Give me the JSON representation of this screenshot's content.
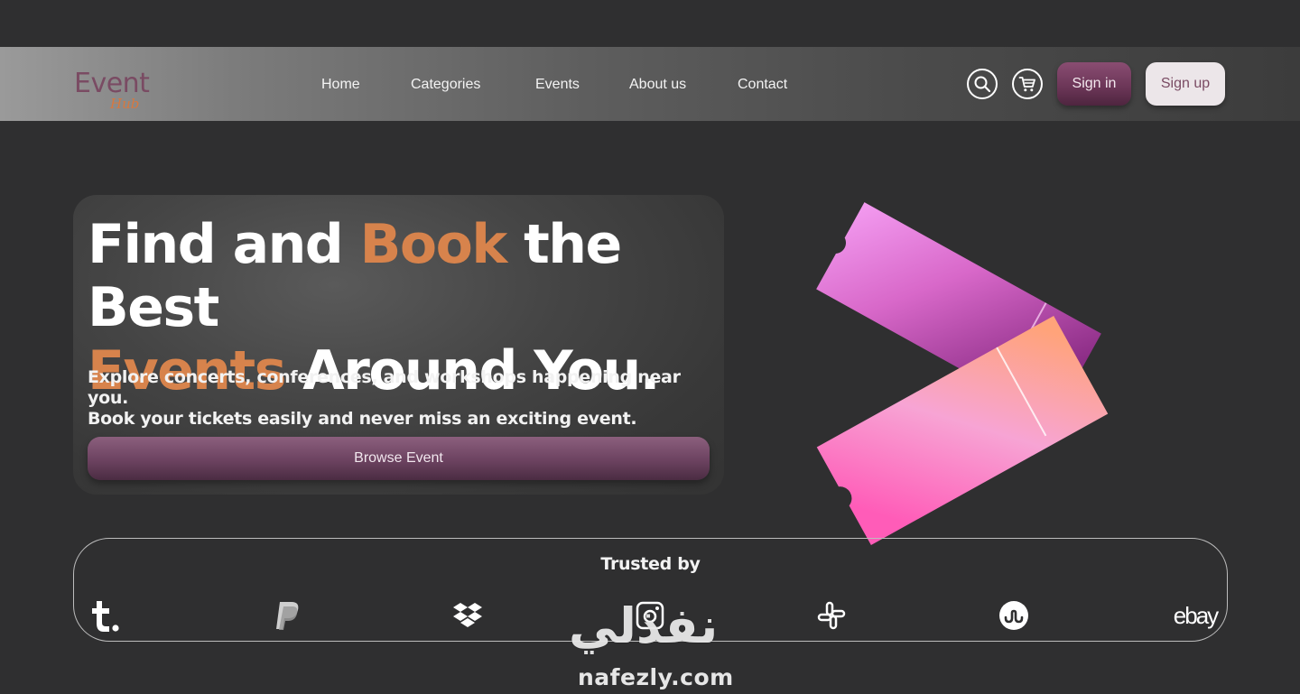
{
  "logo": {
    "main": "Event",
    "sub": "Hub"
  },
  "nav": {
    "links": [
      "Home",
      "Categories",
      "Events",
      "About us",
      "Contact"
    ],
    "search_icon": "search-icon",
    "cart_icon": "cart-icon",
    "signin_label": "Sign in",
    "signup_label": "Sign up"
  },
  "hero": {
    "title_part1": "Find and ",
    "title_accent1": "Book",
    "title_part2": " the Best",
    "title_accent2": "Events",
    "title_part3": " Around You.",
    "description_line1": "Explore concerts, conferences, and workshops happening near you.",
    "description_line2": "Book your tickets easily and never miss an exciting event.",
    "button_label": "Browse Event"
  },
  "trusted": {
    "title": "Trusted by",
    "brands": [
      "tumblr-icon",
      "paypal-icon",
      "dropbox-icon",
      "instagram-icon",
      "slack-icon",
      "stumbleupon-icon",
      "ebay-icon"
    ],
    "ebay_text": "ebay"
  },
  "watermark": {
    "arabic": "نفذلي",
    "latin": "nafezly.com"
  },
  "colors": {
    "accent": "#d7834c",
    "brand_purple": "#6a3556",
    "background": "#2f2f30"
  }
}
